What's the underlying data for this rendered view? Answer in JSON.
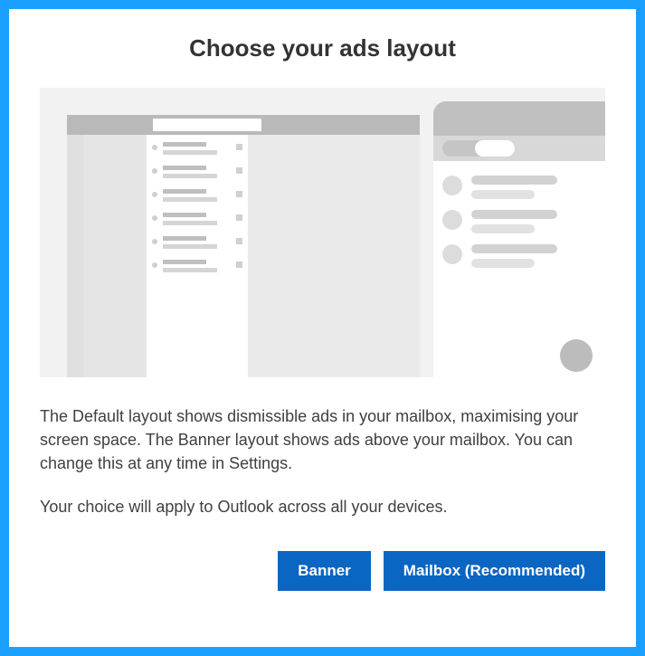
{
  "title": "Choose your ads layout",
  "description": "The Default layout shows dismissible ads in your mailbox, maximising your screen space. The Banner layout shows ads above your mailbox. You can change this at any time in Settings.",
  "note": "Your choice will apply to Outlook across all your devices.",
  "buttons": {
    "banner": "Banner",
    "mailbox": "Mailbox (Recommended)"
  }
}
